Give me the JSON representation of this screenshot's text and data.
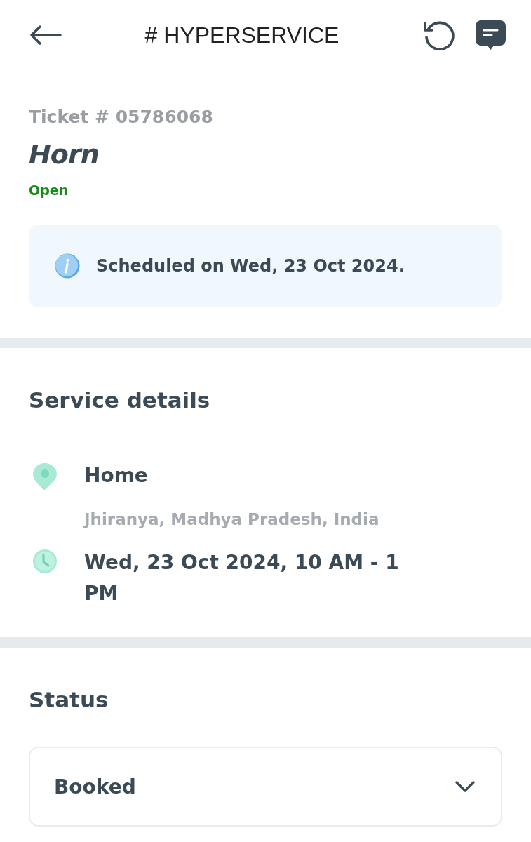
{
  "header": {
    "title": "# HYPERSERVICE"
  },
  "ticket": {
    "number": "Ticket # 05786068",
    "title": "Horn",
    "status": "Open"
  },
  "notice": {
    "text": "Scheduled on Wed, 23 Oct 2024."
  },
  "service_details": {
    "heading": "Service details",
    "items": [
      {
        "kind": "location",
        "label": "Home",
        "detail": "Jhiranya, Madhya Pradesh, India"
      },
      {
        "kind": "time",
        "label": "Wed, 23 Oct 2024, 10 AM - 1 PM"
      }
    ]
  },
  "status_section": {
    "heading": "Status",
    "dropdown": {
      "value": "Booked"
    }
  }
}
